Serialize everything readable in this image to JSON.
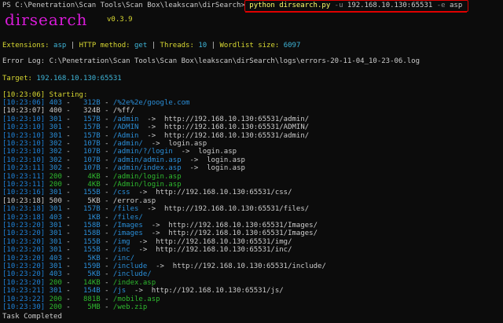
{
  "window": {
    "prompt": "PS C:\\Penetration\\Scan Tools\\Scan Box\\leakscan\\dirSearch>",
    "command": "python dirsearch.py",
    "flag_u": "-u",
    "target_arg": "192.168.10.130:65531",
    "flag_e": "-e",
    "ext_arg": "asp"
  },
  "banner": {
    "logo": "dirsearch",
    "version": "v0.3.9"
  },
  "config": {
    "ext_label": "Extensions:",
    "ext_value": "asp",
    "sep1": "|",
    "method_label": "HTTP method:",
    "method_value": "get",
    "sep2": "|",
    "threads_label": "Threads:",
    "threads_value": "10",
    "sep3": "|",
    "wordlist_label": "Wordlist size:",
    "wordlist_value": "6097"
  },
  "error_log": "Error Log: C:\\Penetration\\Scan Tools\\Scan Box\\leakscan\\dirSearch\\logs\\errors-20-11-04_10-23-06.log",
  "target": {
    "label": "Target:",
    "value": "192.168.10.130:65531"
  },
  "starting": {
    "ts": "[10:23:06]",
    "text": "Starting:"
  },
  "results": [
    {
      "ts": "[10:23:06]",
      "code": "403",
      "size": "312B",
      "path": "/%2e%2e/google.com",
      "redirect": "",
      "color": "blue"
    },
    {
      "ts": "[10:23:07]",
      "code": "400",
      "size": "324B",
      "path": "/%ff/",
      "redirect": "",
      "color": "gray"
    },
    {
      "ts": "[10:23:10]",
      "code": "301",
      "size": "157B",
      "path": "/admin",
      "redirect": "http://192.168.10.130:65531/admin/",
      "color": "blue"
    },
    {
      "ts": "[10:23:10]",
      "code": "301",
      "size": "157B",
      "path": "/ADMIN",
      "redirect": "http://192.168.10.130:65531/ADMIN/",
      "color": "blue"
    },
    {
      "ts": "[10:23:10]",
      "code": "301",
      "size": "157B",
      "path": "/Admin",
      "redirect": "http://192.168.10.130:65531/admin/",
      "color": "blue"
    },
    {
      "ts": "[10:23:10]",
      "code": "302",
      "size": "107B",
      "path": "/admin/",
      "redirect": "login.asp",
      "color": "blue"
    },
    {
      "ts": "[10:23:10]",
      "code": "302",
      "size": "107B",
      "path": "/admin/?/login",
      "redirect": "login.asp",
      "color": "blue"
    },
    {
      "ts": "[10:23:10]",
      "code": "302",
      "size": "107B",
      "path": "/admin/admin.asp",
      "redirect": "login.asp",
      "color": "blue"
    },
    {
      "ts": "[10:23:11]",
      "code": "302",
      "size": "107B",
      "path": "/admin/index.asp",
      "redirect": "login.asp",
      "color": "blue"
    },
    {
      "ts": "[10:23:11]",
      "code": "200",
      "size": "4KB",
      "path": "/admin/login.asp",
      "redirect": "",
      "color": "green"
    },
    {
      "ts": "[10:23:11]",
      "code": "200",
      "size": "4KB",
      "path": "/Admin/login.asp",
      "redirect": "",
      "color": "green"
    },
    {
      "ts": "[10:23:16]",
      "code": "301",
      "size": "155B",
      "path": "/css",
      "redirect": "http://192.168.10.130:65531/css/",
      "color": "blue"
    },
    {
      "ts": "[10:23:18]",
      "code": "500",
      "size": "5KB",
      "path": "/error.asp",
      "redirect": "",
      "color": "gray"
    },
    {
      "ts": "[10:23:18]",
      "code": "301",
      "size": "157B",
      "path": "/files",
      "redirect": "http://192.168.10.130:65531/files/",
      "color": "blue"
    },
    {
      "ts": "[10:23:18]",
      "code": "403",
      "size": "1KB",
      "path": "/files/",
      "redirect": "",
      "color": "blue"
    },
    {
      "ts": "[10:23:20]",
      "code": "301",
      "size": "158B",
      "path": "/Images",
      "redirect": "http://192.168.10.130:65531/Images/",
      "color": "blue"
    },
    {
      "ts": "[10:23:20]",
      "code": "301",
      "size": "158B",
      "path": "/images",
      "redirect": "http://192.168.10.130:65531/Images/",
      "color": "blue"
    },
    {
      "ts": "[10:23:20]",
      "code": "301",
      "size": "155B",
      "path": "/img",
      "redirect": "http://192.168.10.130:65531/img/",
      "color": "blue"
    },
    {
      "ts": "[10:23:20]",
      "code": "301",
      "size": "155B",
      "path": "/inc",
      "redirect": "http://192.168.10.130:65531/inc/",
      "color": "blue"
    },
    {
      "ts": "[10:23:20]",
      "code": "403",
      "size": "5KB",
      "path": "/inc/",
      "redirect": "",
      "color": "blue"
    },
    {
      "ts": "[10:23:20]",
      "code": "301",
      "size": "159B",
      "path": "/include",
      "redirect": "http://192.168.10.130:65531/include/",
      "color": "blue"
    },
    {
      "ts": "[10:23:20]",
      "code": "403",
      "size": "5KB",
      "path": "/include/",
      "redirect": "",
      "color": "blue"
    },
    {
      "ts": "[10:23:20]",
      "code": "200",
      "size": "14KB",
      "path": "/index.asp",
      "redirect": "",
      "color": "green"
    },
    {
      "ts": "[10:23:21]",
      "code": "301",
      "size": "154B",
      "path": "/js",
      "redirect": "http://192.168.10.130:65531/js/",
      "color": "blue"
    },
    {
      "ts": "[10:23:22]",
      "code": "200",
      "size": "881B",
      "path": "/mobile.asp",
      "redirect": "",
      "color": "green"
    },
    {
      "ts": "[10:23:30]",
      "code": "200",
      "size": "5MB",
      "path": "/web.zip",
      "redirect": "",
      "color": "green"
    }
  ],
  "footer": "Task Completed",
  "colors": {
    "background": "#0c0c0c",
    "annotation": "#e00000",
    "green": "#2eb82e",
    "blue": "#2a8ed8",
    "yellow": "#d8d832",
    "magenta": "#d81bd8"
  }
}
